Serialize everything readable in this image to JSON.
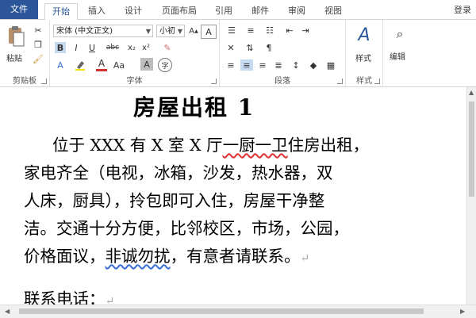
{
  "tabs": {
    "file": "文件",
    "home": "开始",
    "insert": "插入",
    "design": "设计",
    "layout": "页面布局",
    "references": "引用",
    "mailings": "邮件",
    "review": "审阅",
    "view": "视图",
    "login": "登录"
  },
  "ribbon": {
    "clipboard": {
      "label": "剪贴板",
      "paste": "粘贴"
    },
    "font": {
      "label": "字体",
      "font_name": "宋体 (中文正文)",
      "font_size": "小初",
      "bold": "B",
      "italic": "I",
      "underline": "U",
      "strike": "abc",
      "subscript": "x₂",
      "superscript": "x²",
      "font_color": "A",
      "char_shading": "A",
      "enclose": "字"
    },
    "paragraph": {
      "label": "段落"
    },
    "styles": {
      "label": "样式",
      "styles_button": "样式"
    },
    "editing": {
      "editing_button": "编辑"
    }
  },
  "document": {
    "title": "房屋出租 1",
    "lines": [
      "位于 XXX 有 X 室 X 厅",
      "家电齐全（电视，冰箱，沙发，热水器，双",
      "人床，厨具），拎包即可入住，房屋干净整",
      "洁。交通十分方便，比邻校区，市场，公园，",
      "价格面议，",
      "，有意者请联系。"
    ],
    "line1_squiggle": "一厨一卫",
    "line1_tail": "住房出租，",
    "line5_squiggle": "非诚勿扰",
    "contact": "联系电话："
  },
  "colors": {
    "accent": "#2b579a",
    "spell_error": "#d33333",
    "grammar_error": "#3a6fd8"
  }
}
